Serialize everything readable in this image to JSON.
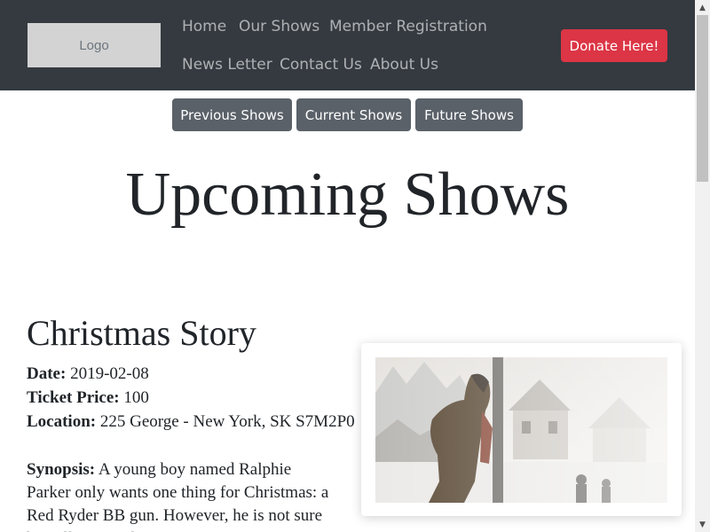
{
  "header": {
    "logo_text": "Logo",
    "nav": [
      {
        "label": "Home"
      },
      {
        "label": "Our Shows"
      },
      {
        "label": "Member Registration"
      },
      {
        "label": "News Letter"
      },
      {
        "label": "Contact Us"
      },
      {
        "label": "About Us"
      }
    ],
    "donate_label": "Donate Here!"
  },
  "filters": [
    {
      "label": "Previous Shows"
    },
    {
      "label": "Current Shows"
    },
    {
      "label": "Future Shows"
    }
  ],
  "page_title": "Upcoming Shows",
  "show": {
    "title": "Christmas Story",
    "date_label": "Date:",
    "date": "2019-02-08",
    "price_label": "Ticket Price:",
    "price": "100",
    "location_label": "Location:",
    "location": "225 George - New York, SK S7M2P0",
    "synopsis_label": "Synopsis:",
    "synopsis": "A young boy named Ralphie Parker only wants one thing for Christmas: a Red Ryder BB gun. However, he is not sure he will ever make"
  },
  "colors": {
    "navbar": "#343a40",
    "donate": "#dc3545",
    "filter_button": "#5a6169"
  }
}
